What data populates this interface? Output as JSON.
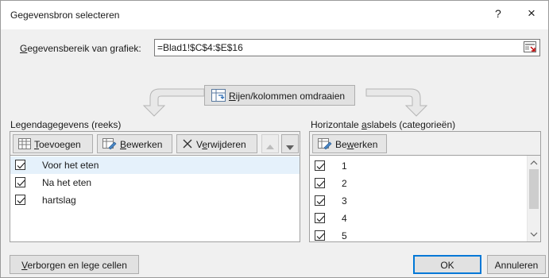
{
  "window": {
    "title": "Gegevensbron selecteren",
    "help_label": "?",
    "close_label": "×"
  },
  "range": {
    "label": "Gegevensbereik van grafiek:",
    "value": "=Blad1!$C$4:$E$16",
    "collapse_icon": "range-collapse-icon"
  },
  "switch_button": {
    "label": "Rijen/kolommen omdraaien",
    "icon": "switch-icon"
  },
  "legend": {
    "title": "Legendagegevens (reeks)",
    "add_label": "Toevoegen",
    "edit_label": "Bewerken",
    "remove_label": "Verwijderen",
    "series": [
      {
        "label": "Voor het eten",
        "checked": true,
        "selected": true
      },
      {
        "label": "Na het eten",
        "checked": true,
        "selected": false
      },
      {
        "label": "hartslag",
        "checked": true,
        "selected": false
      }
    ]
  },
  "axis": {
    "title": "Horizontale aslabels (categorieën)",
    "edit_label": "Bewerken",
    "items": [
      {
        "label": "1",
        "checked": true
      },
      {
        "label": "2",
        "checked": true
      },
      {
        "label": "3",
        "checked": true
      },
      {
        "label": "4",
        "checked": true
      },
      {
        "label": "5",
        "checked": true
      }
    ]
  },
  "footer": {
    "hidden_cells_label": "Verborgen en lege cellen",
    "ok_label": "OK",
    "cancel_label": "Annuleren"
  },
  "colors": {
    "accent": "#0078d7",
    "selection": "#e5f1fb"
  }
}
